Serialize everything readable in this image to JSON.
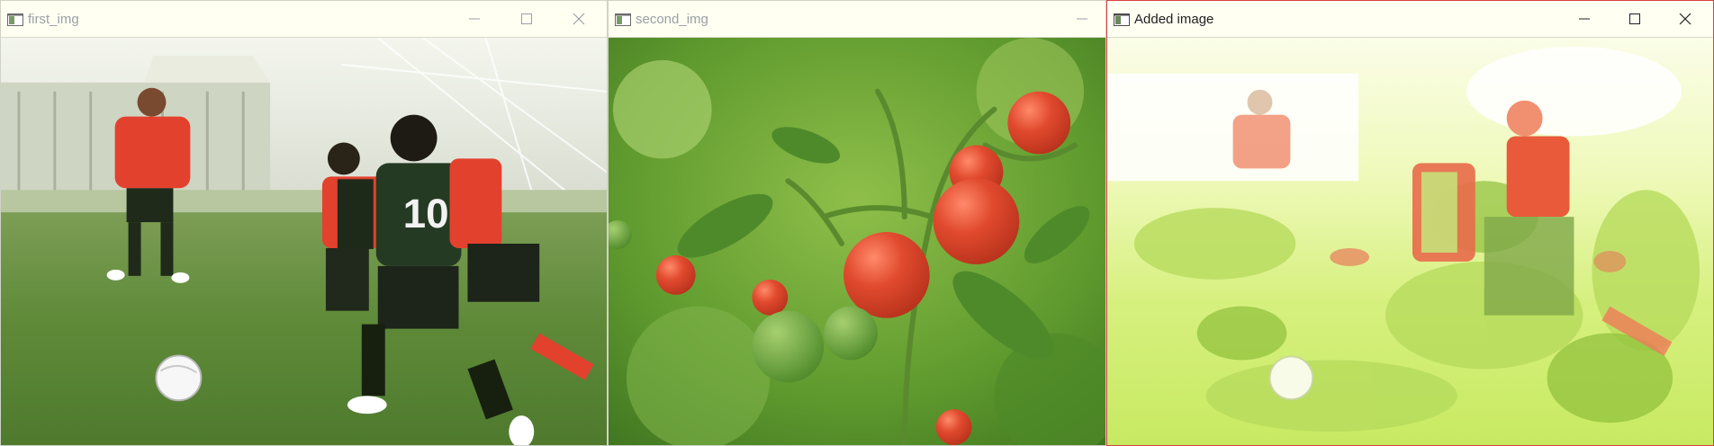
{
  "windows": [
    {
      "title": "first_img",
      "active": false,
      "controls": [
        "minimize-icon",
        "maximize-icon",
        "close-icon"
      ]
    },
    {
      "title": "second_img",
      "active": false,
      "controls": [
        "minimize-icon"
      ]
    },
    {
      "title": "Added image",
      "active": true,
      "controls": [
        "minimize-icon",
        "maximize-icon",
        "close-icon"
      ]
    }
  ],
  "colors": {
    "title_bar_bg": "#fffff2",
    "active_border": "#d9413f",
    "inactive_title_text": "#9aa0a6",
    "active_title_text": "#1f1f1f",
    "grass_green": "#5f8f3a",
    "jersey_red": "#e2412e",
    "tomato_red": "#e14a2e",
    "blend_yellow_green": "#e8f79a"
  }
}
